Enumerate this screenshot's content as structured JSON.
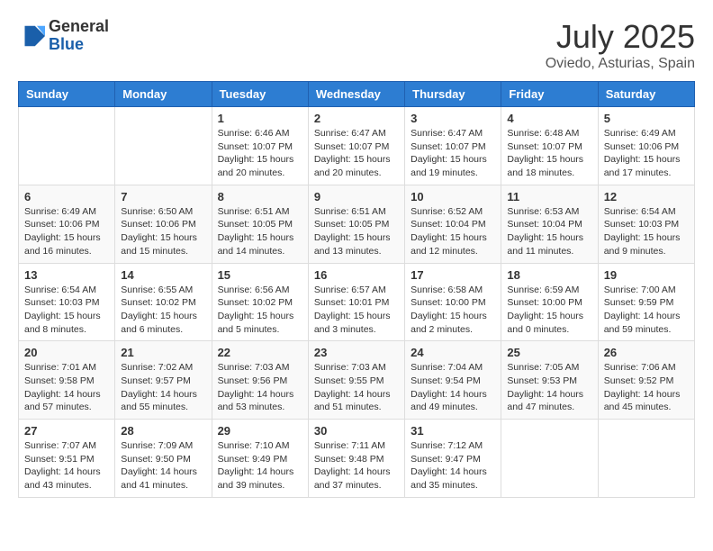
{
  "header": {
    "logo": {
      "general": "General",
      "blue": "Blue"
    },
    "title": "July 2025",
    "location": "Oviedo, Asturias, Spain"
  },
  "calendar": {
    "days_of_week": [
      "Sunday",
      "Monday",
      "Tuesday",
      "Wednesday",
      "Thursday",
      "Friday",
      "Saturday"
    ],
    "weeks": [
      [
        {
          "day": "",
          "info": ""
        },
        {
          "day": "",
          "info": ""
        },
        {
          "day": "1",
          "info": "Sunrise: 6:46 AM\nSunset: 10:07 PM\nDaylight: 15 hours\nand 20 minutes."
        },
        {
          "day": "2",
          "info": "Sunrise: 6:47 AM\nSunset: 10:07 PM\nDaylight: 15 hours\nand 20 minutes."
        },
        {
          "day": "3",
          "info": "Sunrise: 6:47 AM\nSunset: 10:07 PM\nDaylight: 15 hours\nand 19 minutes."
        },
        {
          "day": "4",
          "info": "Sunrise: 6:48 AM\nSunset: 10:07 PM\nDaylight: 15 hours\nand 18 minutes."
        },
        {
          "day": "5",
          "info": "Sunrise: 6:49 AM\nSunset: 10:06 PM\nDaylight: 15 hours\nand 17 minutes."
        }
      ],
      [
        {
          "day": "6",
          "info": "Sunrise: 6:49 AM\nSunset: 10:06 PM\nDaylight: 15 hours\nand 16 minutes."
        },
        {
          "day": "7",
          "info": "Sunrise: 6:50 AM\nSunset: 10:06 PM\nDaylight: 15 hours\nand 15 minutes."
        },
        {
          "day": "8",
          "info": "Sunrise: 6:51 AM\nSunset: 10:05 PM\nDaylight: 15 hours\nand 14 minutes."
        },
        {
          "day": "9",
          "info": "Sunrise: 6:51 AM\nSunset: 10:05 PM\nDaylight: 15 hours\nand 13 minutes."
        },
        {
          "day": "10",
          "info": "Sunrise: 6:52 AM\nSunset: 10:04 PM\nDaylight: 15 hours\nand 12 minutes."
        },
        {
          "day": "11",
          "info": "Sunrise: 6:53 AM\nSunset: 10:04 PM\nDaylight: 15 hours\nand 11 minutes."
        },
        {
          "day": "12",
          "info": "Sunrise: 6:54 AM\nSunset: 10:03 PM\nDaylight: 15 hours\nand 9 minutes."
        }
      ],
      [
        {
          "day": "13",
          "info": "Sunrise: 6:54 AM\nSunset: 10:03 PM\nDaylight: 15 hours\nand 8 minutes."
        },
        {
          "day": "14",
          "info": "Sunrise: 6:55 AM\nSunset: 10:02 PM\nDaylight: 15 hours\nand 6 minutes."
        },
        {
          "day": "15",
          "info": "Sunrise: 6:56 AM\nSunset: 10:02 PM\nDaylight: 15 hours\nand 5 minutes."
        },
        {
          "day": "16",
          "info": "Sunrise: 6:57 AM\nSunset: 10:01 PM\nDaylight: 15 hours\nand 3 minutes."
        },
        {
          "day": "17",
          "info": "Sunrise: 6:58 AM\nSunset: 10:00 PM\nDaylight: 15 hours\nand 2 minutes."
        },
        {
          "day": "18",
          "info": "Sunrise: 6:59 AM\nSunset: 10:00 PM\nDaylight: 15 hours\nand 0 minutes."
        },
        {
          "day": "19",
          "info": "Sunrise: 7:00 AM\nSunset: 9:59 PM\nDaylight: 14 hours\nand 59 minutes."
        }
      ],
      [
        {
          "day": "20",
          "info": "Sunrise: 7:01 AM\nSunset: 9:58 PM\nDaylight: 14 hours\nand 57 minutes."
        },
        {
          "day": "21",
          "info": "Sunrise: 7:02 AM\nSunset: 9:57 PM\nDaylight: 14 hours\nand 55 minutes."
        },
        {
          "day": "22",
          "info": "Sunrise: 7:03 AM\nSunset: 9:56 PM\nDaylight: 14 hours\nand 53 minutes."
        },
        {
          "day": "23",
          "info": "Sunrise: 7:03 AM\nSunset: 9:55 PM\nDaylight: 14 hours\nand 51 minutes."
        },
        {
          "day": "24",
          "info": "Sunrise: 7:04 AM\nSunset: 9:54 PM\nDaylight: 14 hours\nand 49 minutes."
        },
        {
          "day": "25",
          "info": "Sunrise: 7:05 AM\nSunset: 9:53 PM\nDaylight: 14 hours\nand 47 minutes."
        },
        {
          "day": "26",
          "info": "Sunrise: 7:06 AM\nSunset: 9:52 PM\nDaylight: 14 hours\nand 45 minutes."
        }
      ],
      [
        {
          "day": "27",
          "info": "Sunrise: 7:07 AM\nSunset: 9:51 PM\nDaylight: 14 hours\nand 43 minutes."
        },
        {
          "day": "28",
          "info": "Sunrise: 7:09 AM\nSunset: 9:50 PM\nDaylight: 14 hours\nand 41 minutes."
        },
        {
          "day": "29",
          "info": "Sunrise: 7:10 AM\nSunset: 9:49 PM\nDaylight: 14 hours\nand 39 minutes."
        },
        {
          "day": "30",
          "info": "Sunrise: 7:11 AM\nSunset: 9:48 PM\nDaylight: 14 hours\nand 37 minutes."
        },
        {
          "day": "31",
          "info": "Sunrise: 7:12 AM\nSunset: 9:47 PM\nDaylight: 14 hours\nand 35 minutes."
        },
        {
          "day": "",
          "info": ""
        },
        {
          "day": "",
          "info": ""
        }
      ]
    ]
  }
}
